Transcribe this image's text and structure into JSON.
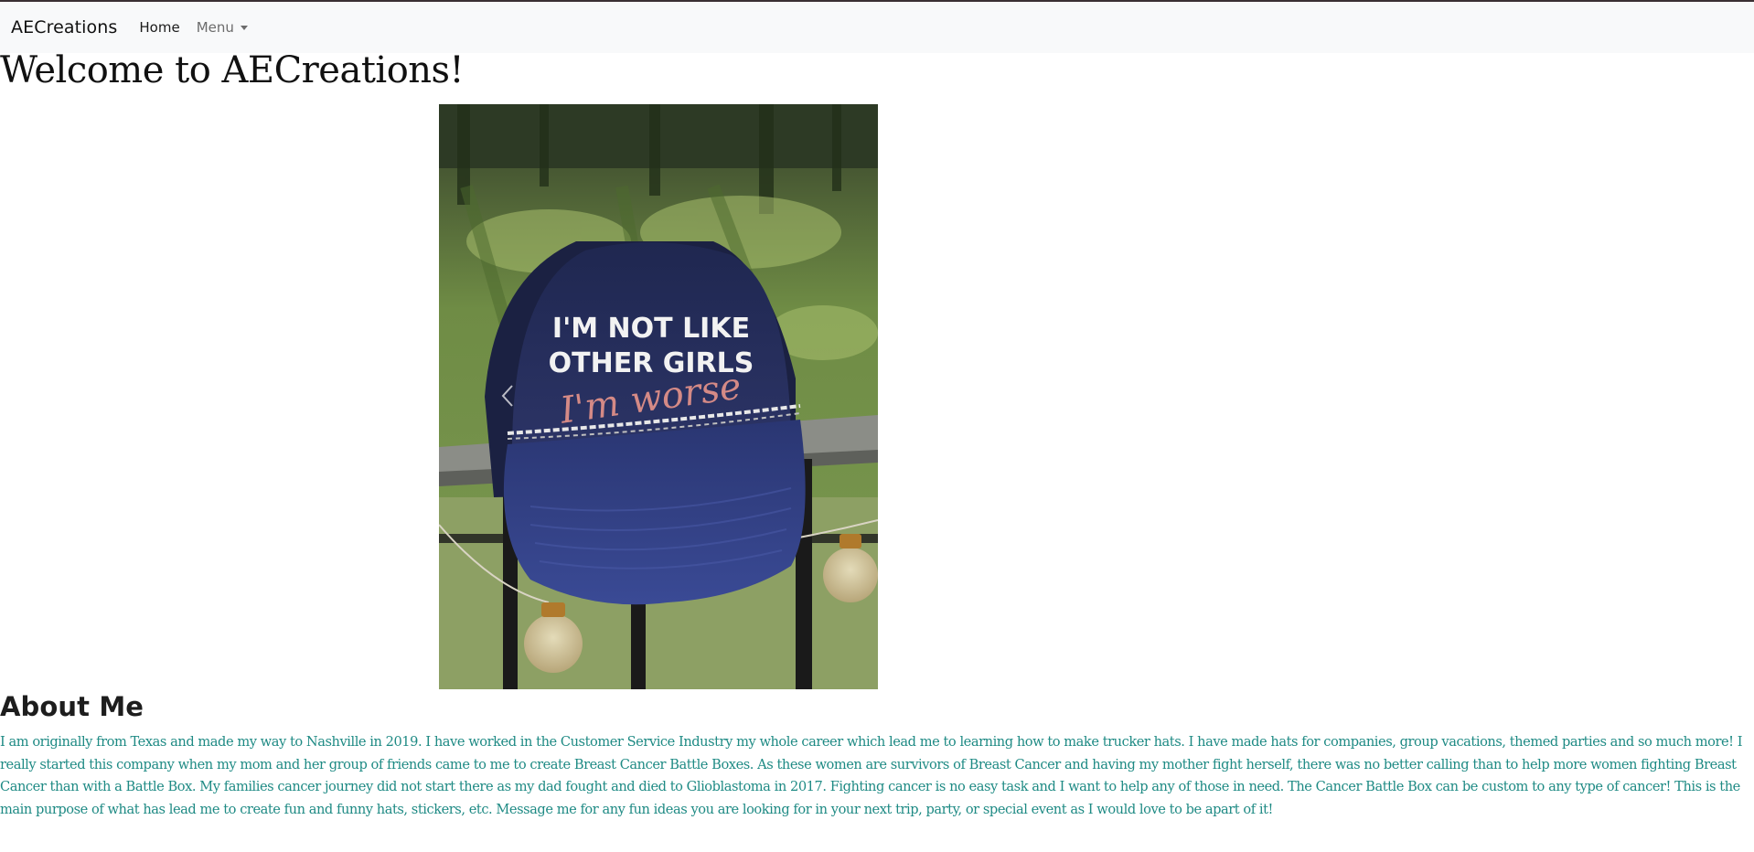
{
  "navbar": {
    "brand": "AECreations",
    "items": [
      {
        "label": "Home"
      },
      {
        "label": "Menu"
      }
    ]
  },
  "hero": {
    "title": "Welcome to AECreations!",
    "hat_text_line1": "I'M NOT LIKE",
    "hat_text_line2": "OTHER GIRLS",
    "hat_text_script": "I'm worse"
  },
  "about": {
    "heading": "About Me",
    "body": "I am originally from Texas and made my way to Nashville in 2019. I have worked in the Customer Service Industry my whole career which lead me to learning how to make trucker hats. I have made hats for companies, group vacations, themed parties and so much more! I really started this company when my mom and her group of friends came to me to create Breast Cancer Battle Boxes. As these women are survivors of Breast Cancer and having my mother fight herself, there was no better calling than to help more women fighting Breast Cancer than with a Battle Box. My families cancer journey did not start there as my dad fought and died to Glioblastoma in 2017. Fighting cancer is no easy task and I want to help any of those in need. The Cancer Battle Box can be custom to any type of cancer! This is the main purpose of what has lead me to create fun and funny hats, stickers, etc. Message me for any fun ideas you are looking for in your next trip, party, or special event as I would love to be apart of it!"
  },
  "colors": {
    "navbar_bg": "#f8f9fa",
    "about_text": "#1e8a84",
    "hat_navy": "#27305e"
  },
  "icons": {
    "carousel_prev": "chevron-left-icon",
    "menu_caret": "caret-down-icon"
  }
}
